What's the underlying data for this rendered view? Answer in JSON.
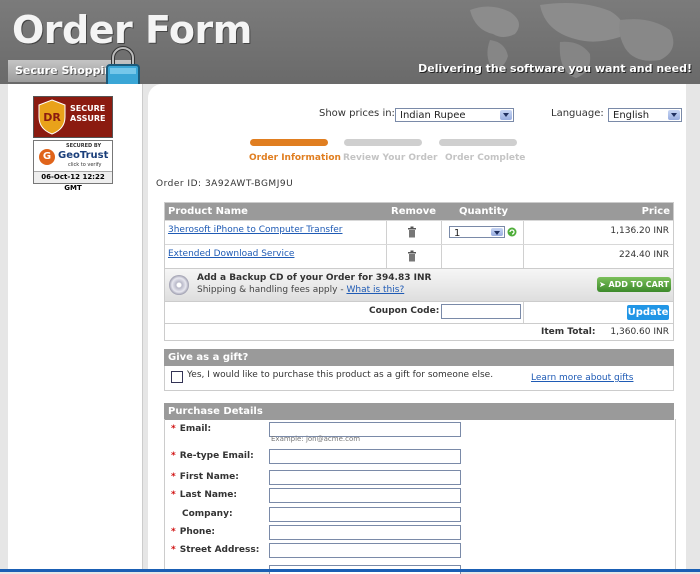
{
  "header": {
    "title": "Order Form",
    "tagline": "Delivering the software you want and need!",
    "secure_tab": "Secure Shopping"
  },
  "badges": {
    "dr_line1": "SECURE",
    "dr_line2": "ASSURE",
    "dr_logo": "DR",
    "geo_secured": "SECURED BY",
    "geo_name": "GeoTrust",
    "geo_click": "click to verify",
    "geo_date": "06-Oct-12 12:22 GMT"
  },
  "settings": {
    "prices_label": "Show prices in:",
    "currency": "Indian Rupee",
    "language_label": "Language:",
    "language": "English"
  },
  "steps": [
    {
      "label": "Order Information",
      "active": true
    },
    {
      "label": "Review Your Order",
      "active": false
    },
    {
      "label": "Order Complete",
      "active": false
    }
  ],
  "order": {
    "order_id_label": "Order ID:",
    "order_id": "3A92AWT-BGMJ9U"
  },
  "cart": {
    "headers": {
      "product": "Product Name",
      "remove": "Remove",
      "quantity": "Quantity",
      "price": "Price"
    },
    "items": [
      {
        "name": "3herosoft iPhone to Computer Transfer",
        "quantity": "1",
        "price": "1,136.20 INR"
      },
      {
        "name": "Extended Download Service",
        "quantity": "",
        "price": "224.40 INR"
      }
    ],
    "backup_title": "Add a Backup CD of your Order for 394.83 INR",
    "backup_sub": "Shipping & handling fees apply -",
    "backup_link": "What is this?",
    "add_to_cart": "ADD TO CART",
    "coupon_label": "Coupon Code:",
    "update": "Update",
    "total_label": "Item Total:",
    "total_value": "1,360.60 INR"
  },
  "gift": {
    "heading": "Give as a gift?",
    "checkbox_label": "Yes, I would like to purchase this product as a gift for someone else.",
    "learn_more": "Learn more about gifts"
  },
  "purchase": {
    "heading": "Purchase Details",
    "email_hint": "Example: jon@acme.com",
    "fields": [
      {
        "label": "Email:",
        "required": true
      },
      {
        "label": "Re-type Email:",
        "required": true
      },
      {
        "label": "First Name:",
        "required": true
      },
      {
        "label": "Last Name:",
        "required": true
      },
      {
        "label": "Company:",
        "required": false
      },
      {
        "label": "Phone:",
        "required": true
      },
      {
        "label": "Street Address:",
        "required": true
      }
    ]
  },
  "colors": {
    "active_step": "#e07e20",
    "inactive_step": "#cfcfcf",
    "section_header": "#9a9a9a",
    "link": "#1f5bb5",
    "update_button": "#2196e6",
    "add_cart_button": "#4a9a36"
  }
}
